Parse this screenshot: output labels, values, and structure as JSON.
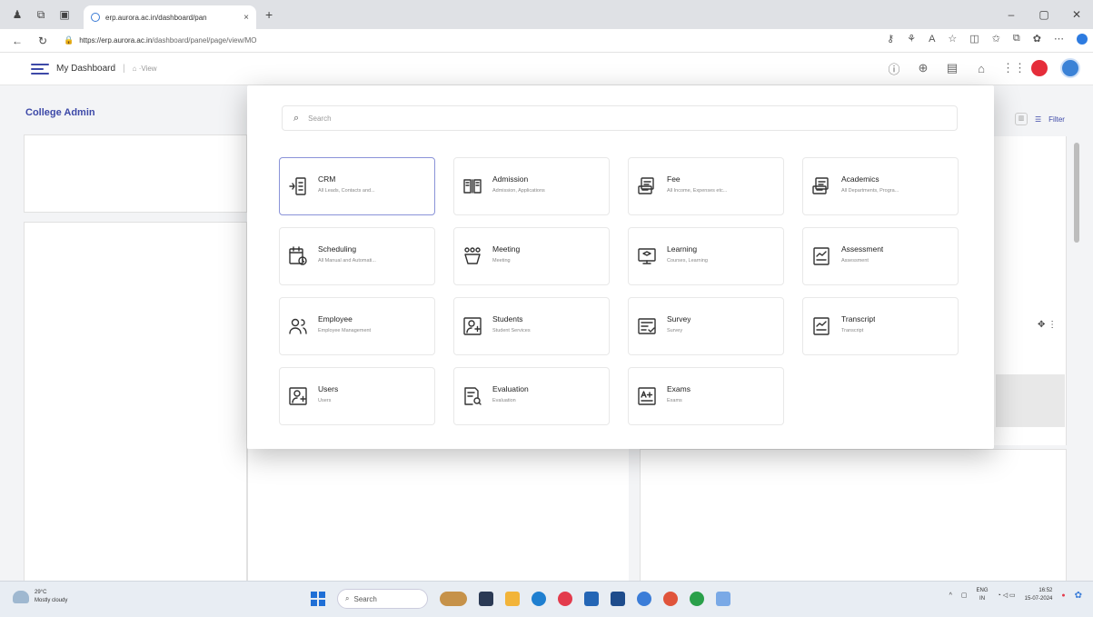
{
  "browser": {
    "tab_title": "erp.aurora.ac.in/dashboard/pan",
    "tab_close": "×",
    "new_tab": "+",
    "url_host": "https://erp.aurora.ac.in",
    "url_path": "/dashboard/panel/page/view/MO",
    "window_controls": [
      "–",
      "▢",
      "✕"
    ]
  },
  "app": {
    "title": "My Dashboard",
    "breadcrumb": "View",
    "sidebar_title": "College Admin",
    "filter_label": "Filter"
  },
  "modal": {
    "search_placeholder": "Search",
    "tiles": [
      {
        "name": "CRM",
        "desc": "All Leads, Contacts and...",
        "icon": "crm-icon"
      },
      {
        "name": "Admission",
        "desc": "Admission, Applications",
        "icon": "admission-icon"
      },
      {
        "name": "Fee",
        "desc": "All Income, Expenses etc...",
        "icon": "fee-icon"
      },
      {
        "name": "Academics",
        "desc": "All Departments, Progra...",
        "icon": "academics-icon"
      },
      {
        "name": "Scheduling",
        "desc": "All Manual and Automati...",
        "icon": "scheduling-icon"
      },
      {
        "name": "Meeting",
        "desc": "Meeting",
        "icon": "meeting-icon"
      },
      {
        "name": "Learning",
        "desc": "Courses, Learning",
        "icon": "learning-icon"
      },
      {
        "name": "Assessment",
        "desc": "Assessment",
        "icon": "assessment-icon"
      },
      {
        "name": "Employee",
        "desc": "Employee Management",
        "icon": "employee-icon"
      },
      {
        "name": "Students",
        "desc": "Student Services",
        "icon": "students-icon"
      },
      {
        "name": "Survey",
        "desc": "Survey",
        "icon": "survey-icon"
      },
      {
        "name": "Transcript",
        "desc": "Transcript",
        "icon": "transcript-icon"
      },
      {
        "name": "Users",
        "desc": "Users",
        "icon": "users-icon"
      },
      {
        "name": "Evaluation",
        "desc": "Evaluation",
        "icon": "evaluation-icon"
      },
      {
        "name": "Exams",
        "desc": "Exams",
        "icon": "exams-icon"
      }
    ]
  },
  "taskbar": {
    "weather_temp": "29°C",
    "weather_desc": "Mostly cloudy",
    "search": "Search",
    "lang_top": "ENG",
    "lang_bottom": "IN",
    "time": "16:52",
    "date": "15-07-2024"
  },
  "colors": {
    "accent": "#3d49a8",
    "notification": "#e52d3a"
  }
}
